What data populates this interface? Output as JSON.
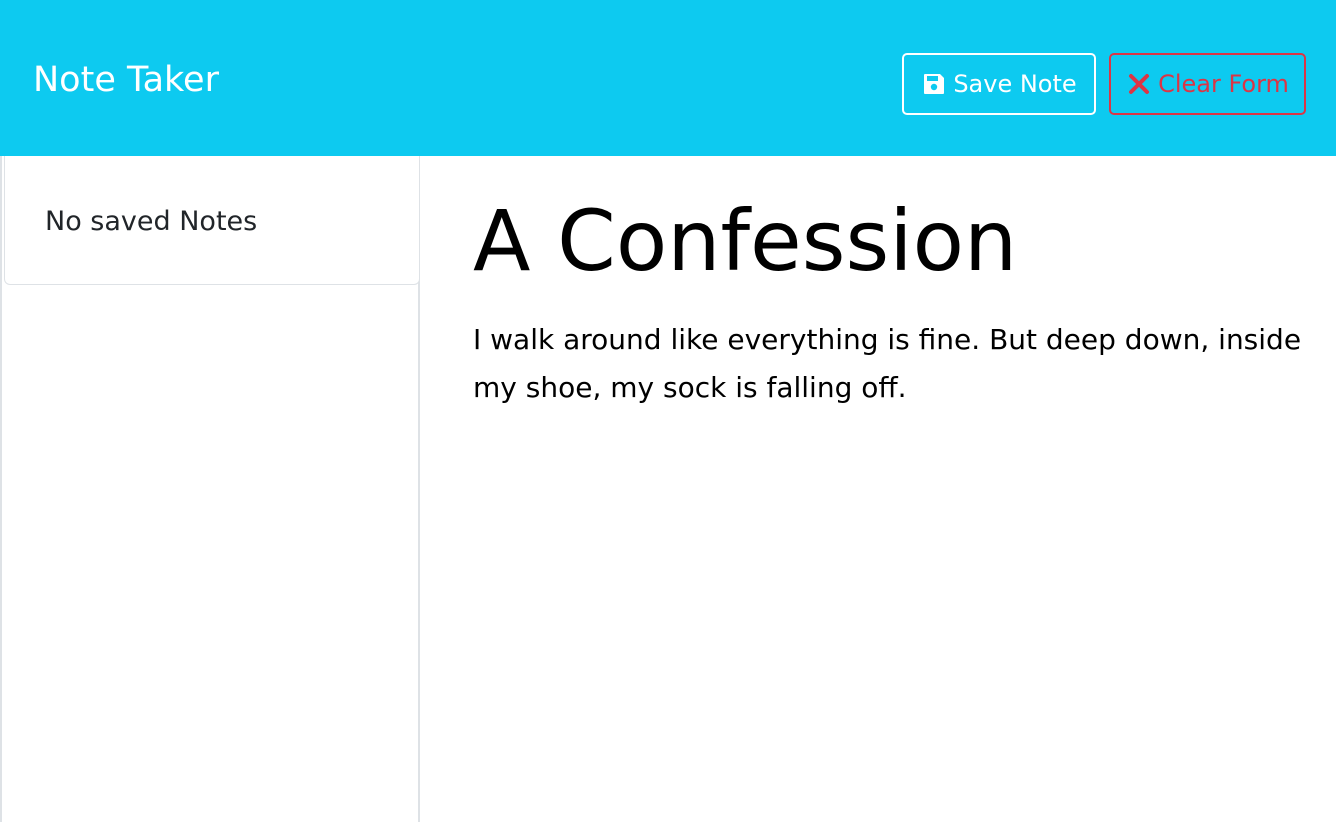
{
  "app": {
    "brand": "Note Taker",
    "accent_color": "#0dcaf0"
  },
  "toolbar": {
    "save_icon": "floppy-disk-icon",
    "save_label": "Save Note",
    "clear_icon": "x-icon",
    "clear_label": "Clear Form",
    "clear_color": "#dc3545"
  },
  "sidebar": {
    "items": [
      {
        "label": "No saved Notes"
      }
    ]
  },
  "note": {
    "title": "A Confession",
    "text": "I walk around like everything is fine. But deep down, inside my shoe, my sock is falling off."
  }
}
